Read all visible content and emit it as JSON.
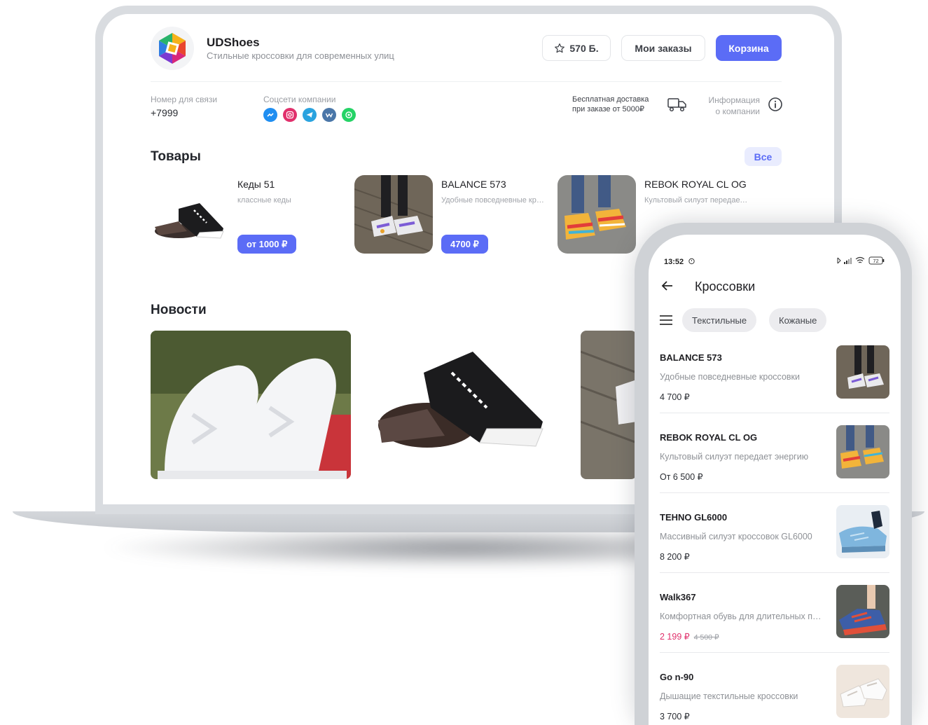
{
  "desktop": {
    "brand": {
      "name": "UDShoes",
      "tagline": "Стильные кроссовки для современных улиц"
    },
    "header_buttons": {
      "points": "570 Б.",
      "orders": "Мои заказы",
      "cart": "Корзина"
    },
    "contact": {
      "label": "Номер для связи",
      "value": "+7999"
    },
    "socials": {
      "label": "Соцсети компании",
      "icons": [
        "messenger-icon",
        "instagram-icon",
        "telegram-icon",
        "vk-icon",
        "whatsapp-icon"
      ],
      "colors": [
        "#1f8ef1",
        "#e1306c",
        "#2aa3df",
        "#4a76a8",
        "#25d366"
      ]
    },
    "delivery": {
      "line1": "Бесплатная доставка",
      "line2": "при заказе от 5000₽"
    },
    "info": {
      "line1": "Информация",
      "line2": "о компании"
    },
    "products_section": {
      "title": "Товары",
      "all_label": "Все",
      "items": [
        {
          "name": "Кеды 51",
          "desc": "классные кеды",
          "price": "от 1000 ₽"
        },
        {
          "name": "BALANCE 573",
          "desc": "Удобные повседневные кроссовки",
          "price": "4700 ₽"
        },
        {
          "name": "REBOK ROYAL CL OG",
          "desc": "Культовый силуэт передает энергию"
        }
      ]
    },
    "news_section": {
      "title": "Новости"
    }
  },
  "phone": {
    "status": {
      "time": "13:52",
      "battery": "72"
    },
    "title": "Кроссовки",
    "chips": [
      "Текстильные",
      "Кожаные"
    ],
    "items": [
      {
        "name": "BALANCE 573",
        "desc": "Удобные повседневные кроссовки",
        "price": "4 700 ₽"
      },
      {
        "name": "REBOK ROYAL CL OG",
        "desc": "Культовый силуэт передает энергию",
        "price": "От 6 500 ₽"
      },
      {
        "name": "TEHNO GL6000",
        "desc": "Массивный силуэт кроссовок GL6000",
        "price": "8 200 ₽"
      },
      {
        "name": "Walk367",
        "desc": "Комфортная обувь для длительных прогулок",
        "price": "2 199 ₽",
        "old_price": "4 500 ₽"
      },
      {
        "name": "Go n-90",
        "desc": "Дышащие текстильные кроссовки",
        "price": "3 700 ₽"
      }
    ]
  },
  "colors": {
    "accent": "#5b6cf6",
    "sale": "#e0306b"
  }
}
